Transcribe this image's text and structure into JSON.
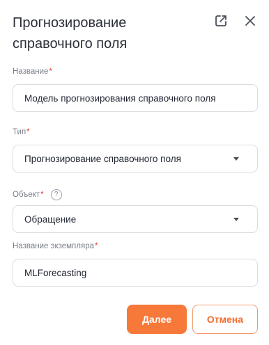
{
  "dialog": {
    "title": "Прогнозирование справочного поля",
    "open_icon": "external-link-icon",
    "close_icon": "close-icon"
  },
  "form": {
    "name": {
      "label": "Название",
      "required_mark": "*",
      "value": "Модель прогнозирования справочного поля"
    },
    "type": {
      "label": "Тип",
      "required_mark": "*",
      "value": "Прогнозирование справочного поля"
    },
    "object": {
      "label": "Объект",
      "required_mark": "*",
      "help": "?",
      "value": "Обращение"
    },
    "instance": {
      "label": "Название экземпляра",
      "required_mark": "*",
      "value": "MLForecasting"
    }
  },
  "actions": {
    "next_label": "Далее",
    "cancel_label": "Отмена"
  },
  "colors": {
    "accent": "#f7793a",
    "required": "#e53935",
    "border": "#d9dce1"
  }
}
